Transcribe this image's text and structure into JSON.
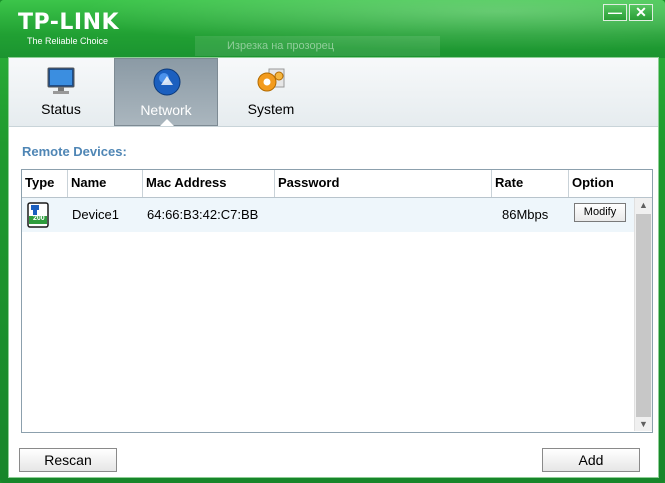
{
  "window": {
    "logo": "TP-LINK",
    "tagline": "The Reliable Choice",
    "ghost_title": "Изрезка на прозорец",
    "minimize_glyph": "—",
    "close_glyph": "✕"
  },
  "tabs": [
    {
      "label": "Status",
      "icon": "monitor-icon",
      "active": false
    },
    {
      "label": "Network",
      "icon": "globe-icon",
      "active": true
    },
    {
      "label": "System",
      "icon": "gear-icon",
      "active": false
    }
  ],
  "section_title": "Remote Devices:",
  "table": {
    "columns": [
      "Type",
      "Name",
      "Mac Address",
      "Password",
      "Rate",
      "Option"
    ],
    "rows": [
      {
        "type_icon": "powerline-device-icon",
        "type_badge": "200",
        "name": "Device1",
        "mac": "64:66:B3:42:C7:BB",
        "password": "",
        "rate": "86Mbps",
        "option": "Modify"
      }
    ]
  },
  "buttons": {
    "rescan": "Rescan",
    "add": "Add"
  },
  "colors": {
    "accent_green": "#1f9a2e",
    "section_title": "#4f86b5",
    "active_tab": "#8b9aa5"
  }
}
